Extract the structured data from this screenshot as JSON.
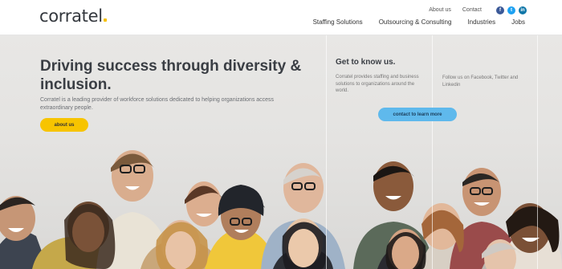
{
  "header": {
    "logo": "corratel",
    "top_links": [
      "About us",
      "Contact"
    ],
    "social": [
      {
        "icon": "facebook-icon",
        "glyph": "f",
        "color": "#3b5998"
      },
      {
        "icon": "twitter-icon",
        "glyph": "t",
        "color": "#1da1f2"
      },
      {
        "icon": "linkedin-icon",
        "glyph": "in",
        "color": "#0e76a8"
      }
    ],
    "nav": [
      "Staffing Solutions",
      "Outsourcing & Consulting",
      "Industries",
      "Jobs"
    ]
  },
  "hero": {
    "headline": "Driving success through diversity & inclusion.",
    "lead": "Corratel is a leading provider of workforce solutions dedicated to helping organizations access extraordinary people.",
    "cta_label": "about us"
  },
  "panel": {
    "title": "Get to know us.",
    "text": "Corratel provides staffing and business solutions to organizations around the world.",
    "follow_text": "Follow us on Facebook, Twitter and Linkedin",
    "cta_label": "contact to learn more"
  },
  "colors": {
    "accent_yellow": "#f7c400",
    "accent_blue": "#5fb9ec",
    "text_dark": "#3a3e44"
  }
}
